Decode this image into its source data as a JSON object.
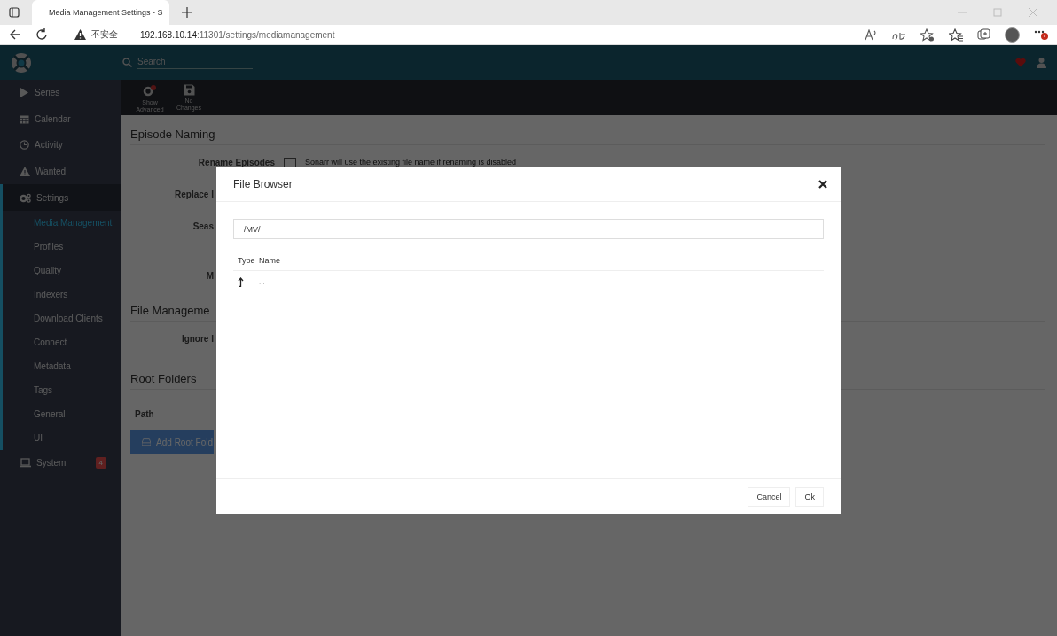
{
  "browser": {
    "tab_title": "Media Management Settings - S",
    "insecure_label": "不安全",
    "url_host": "192.168.10.14",
    "url_rest": ":11301/settings/mediamanagement"
  },
  "header": {
    "search": {
      "placeholder": "Search"
    }
  },
  "sidebar": {
    "items": [
      {
        "kind": "main",
        "label": "Series",
        "selected": false
      },
      {
        "kind": "main",
        "label": "Calendar",
        "selected": false
      },
      {
        "kind": "main",
        "label": "Activity",
        "selected": false
      },
      {
        "kind": "main",
        "label": "Wanted",
        "selected": false
      },
      {
        "kind": "main",
        "label": "Settings",
        "selected": true
      },
      {
        "kind": "sub",
        "label": "Media Management",
        "selected": true
      },
      {
        "kind": "sub",
        "label": "Profiles",
        "selected": false
      },
      {
        "kind": "sub",
        "label": "Quality",
        "selected": false
      },
      {
        "kind": "sub",
        "label": "Indexers",
        "selected": false
      },
      {
        "kind": "sub",
        "label": "Download Clients",
        "selected": false
      },
      {
        "kind": "sub",
        "label": "Connect",
        "selected": false
      },
      {
        "kind": "sub",
        "label": "Metadata",
        "selected": false
      },
      {
        "kind": "sub",
        "label": "Tags",
        "selected": false
      },
      {
        "kind": "sub",
        "label": "General",
        "selected": false
      },
      {
        "kind": "sub",
        "label": "UI",
        "selected": false
      },
      {
        "kind": "main",
        "label": "System",
        "selected": false,
        "badge": "4"
      }
    ]
  },
  "toolbar": {
    "buttons": [
      {
        "label": "Show Advanced"
      },
      {
        "label": "No Changes"
      }
    ]
  },
  "content": {
    "sections": [
      {
        "title": "Episode Naming",
        "fields": [
          {
            "kind": "checkbox",
            "label": "Rename Episodes",
            "checked": false,
            "help": "Sonarr will use the existing file name if renaming is disabled"
          },
          {
            "kind": "covered",
            "label": "Replace I"
          },
          {
            "kind": "covered",
            "label": "Seas"
          },
          {
            "kind": "covered_tall",
            "label": "M"
          }
        ]
      },
      {
        "title": "File Manageme",
        "fields": [
          {
            "kind": "covered",
            "label": "Ignore I"
          }
        ]
      },
      {
        "title": "Root Folders",
        "fields": [
          {
            "kind": "column",
            "label": "Path"
          }
        ],
        "button": "Add Root Fold"
      }
    ]
  },
  "modal": {
    "title": "File Browser",
    "path": "/MV/",
    "columns": [
      "Type",
      "Name"
    ],
    "rows": [
      {
        "kind": "parent",
        "name": "..."
      }
    ],
    "buttons": [
      "Cancel",
      "Ok"
    ]
  }
}
